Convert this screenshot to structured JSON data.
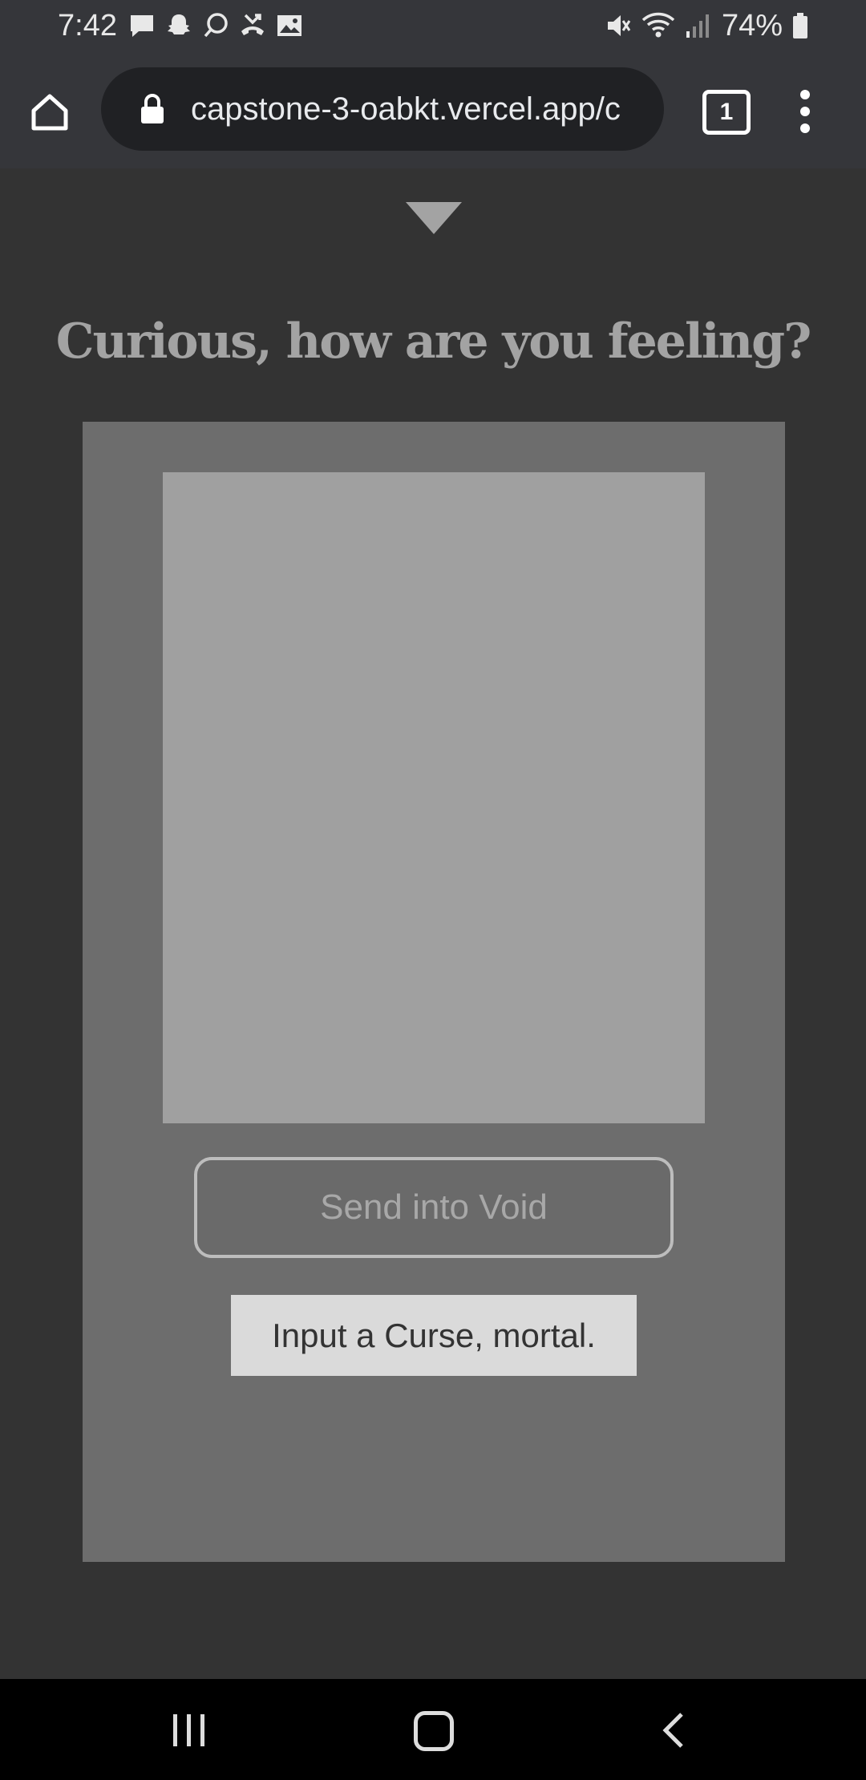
{
  "status_bar": {
    "time": "7:42",
    "notification_icons": [
      "message-icon",
      "snapchat-icon",
      "chat-bubble-icon",
      "missed-call-icon",
      "image-icon"
    ],
    "right_icons": [
      "mute-icon",
      "wifi-icon",
      "signal-icon"
    ],
    "battery_percent": "74%"
  },
  "browser": {
    "url": "capstone-3-oabkt.vercel.app/c",
    "tab_count": "1"
  },
  "page": {
    "heading": "Curious, how are you feeling?",
    "input_placeholder": "",
    "send_button_label": "Send into Void",
    "hint_text": "Input a Curse, mortal."
  },
  "colors": {
    "page_background": "#333333",
    "card_background": "#6d6d6d",
    "input_background": "#a0a0a0",
    "heading_color": "#a3a3a3",
    "hint_background": "#dadada"
  }
}
